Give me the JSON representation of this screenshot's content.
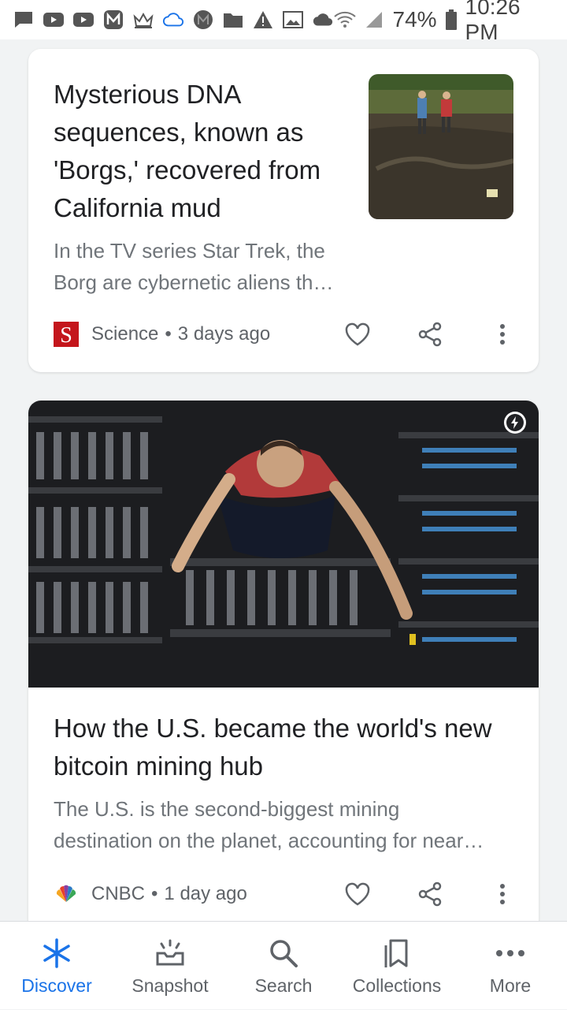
{
  "status_bar": {
    "battery": "74%",
    "time": "10:26 PM",
    "notification_icons": [
      "message-icon",
      "youtube-icon",
      "youtube-icon",
      "m-app-icon",
      "crown-icon",
      "cloud-outline-icon",
      "m-circle-icon",
      "folder-icon",
      "warning-icon",
      "image-icon",
      "cloud-icon"
    ],
    "system_icons": [
      "wifi-icon",
      "signal-icon",
      "battery-icon"
    ]
  },
  "cards": [
    {
      "title": "Mysterious DNA sequences, known as 'Borgs,' recovered from California mud",
      "snippet_line1": "In the TV series Star Trek, the",
      "snippet_line2": "Borg are cybernetic aliens th…",
      "source": "Science",
      "separator": "•",
      "time": "3 days ago",
      "source_logo_letter": "S",
      "source_logo_color": "#c4161c"
    },
    {
      "title": "How the U.S. became the world's new bitcoin mining hub",
      "snippet_line1": "The U.S. is the second-biggest mining",
      "snippet_line2": "destination on the planet, accounting for near…",
      "source": "CNBC",
      "separator": "•",
      "time": "1 day ago"
    }
  ],
  "bottom_nav": {
    "items": [
      {
        "label": "Discover",
        "icon": "asterisk-icon",
        "active": true
      },
      {
        "label": "Snapshot",
        "icon": "snapshot-icon",
        "active": false
      },
      {
        "label": "Search",
        "icon": "search-icon",
        "active": false
      },
      {
        "label": "Collections",
        "icon": "collections-icon",
        "active": false
      },
      {
        "label": "More",
        "icon": "more-horizontal-icon",
        "active": false
      }
    ]
  },
  "colors": {
    "accent": "#1a73e8",
    "title_text": "#202124",
    "snippet_text": "#70757a",
    "meta_text": "#5f6368",
    "background": "#f1f3f4"
  }
}
